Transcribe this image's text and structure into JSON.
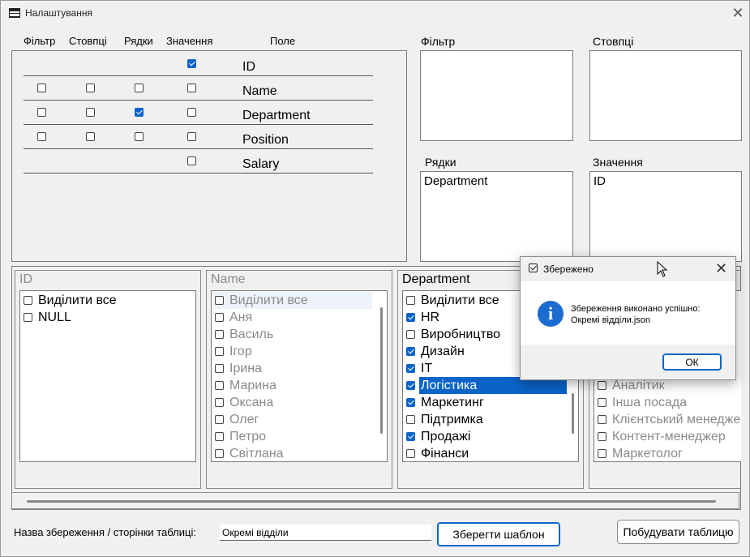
{
  "window": {
    "title": "Налаштування"
  },
  "grid": {
    "headers": {
      "filter": "Фільтр",
      "columns": "Стовпці",
      "rows": "Рядки",
      "values": "Значення",
      "field": "Поле"
    },
    "fields": [
      {
        "name": "ID",
        "filter": null,
        "columns": null,
        "rows": null,
        "values": true
      },
      {
        "name": "Name",
        "filter": false,
        "columns": false,
        "rows": false,
        "values": false
      },
      {
        "name": "Department",
        "filter": false,
        "columns": false,
        "rows": true,
        "values": false
      },
      {
        "name": "Position",
        "filter": false,
        "columns": false,
        "rows": false,
        "values": false
      },
      {
        "name": "Salary",
        "filter": null,
        "columns": null,
        "rows": null,
        "values": false
      }
    ]
  },
  "areas": {
    "filter_label": "Фільтр",
    "columns_label": "Стовпці",
    "rows_label": "Рядки",
    "rows_value": "Department",
    "values_label": "Значення",
    "values_value": "ID"
  },
  "filters": {
    "id": {
      "title": "ID",
      "items": [
        "Виділити все",
        "NULL"
      ]
    },
    "name": {
      "title": "Name",
      "items": [
        "Виділити все",
        "Аня",
        "Василь",
        "Ігор",
        "Ірина",
        "Марина",
        "Оксана",
        "Олег",
        "Петро",
        "Світлана"
      ]
    },
    "department": {
      "title": "Department",
      "items": [
        {
          "label": "Виділити все",
          "checked": false
        },
        {
          "label": "HR",
          "checked": true
        },
        {
          "label": "Виробництво",
          "checked": false
        },
        {
          "label": "Дизайн",
          "checked": true
        },
        {
          "label": "IT",
          "checked": true
        },
        {
          "label": "Логістика",
          "checked": true,
          "selected": true
        },
        {
          "label": "Маркетинг",
          "checked": true
        },
        {
          "label": "Підтримка",
          "checked": false
        },
        {
          "label": "Продажі",
          "checked": true
        },
        {
          "label": "Фінанси",
          "checked": false
        }
      ]
    },
    "position": {
      "items": [
        "Аналітик",
        "Інша посада",
        "Клієнтський менедже",
        "Контент-менеджер",
        "Маркетолог"
      ]
    }
  },
  "bottom": {
    "save_name_label": "Назва збереження / сторінки таблиці:",
    "save_name_value": "Окремі відділи",
    "save_template_button": "Зберегти шаблон",
    "build_table_button": "Побудувати таблицю"
  },
  "dialog": {
    "title": "Збережено",
    "message_line1": "Збереження виконано успішно:",
    "message_line2": "Окремі відділи.json",
    "ok_button": "ОК"
  }
}
